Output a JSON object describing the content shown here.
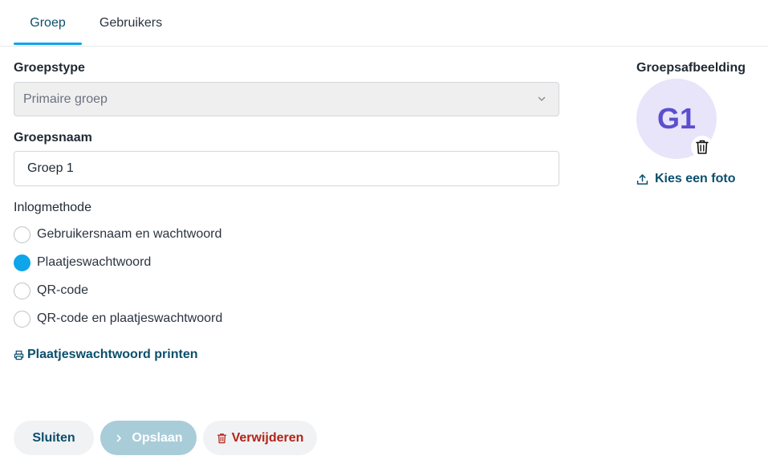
{
  "tabs": [
    {
      "label": "Groep",
      "active": true
    },
    {
      "label": "Gebruikers",
      "active": false
    }
  ],
  "form": {
    "group_type_label": "Groepstype",
    "group_type_value": "Primaire groep",
    "group_name_label": "Groepsnaam",
    "group_name_value": "Groep 1",
    "login_method_label": "Inlogmethode",
    "login_options": [
      {
        "label": "Gebruikersnaam en wachtwoord",
        "checked": false
      },
      {
        "label": "Plaatjeswachtwoord",
        "checked": true
      },
      {
        "label": "QR-code",
        "checked": false
      },
      {
        "label": "QR-code en plaatjeswachtwoord",
        "checked": false
      }
    ],
    "print_link": "Plaatjeswachtwoord printen"
  },
  "image": {
    "label": "Groepsafbeelding",
    "avatar_text": "G1",
    "choose_photo": "Kies een foto"
  },
  "actions": {
    "close": "Sluiten",
    "save": "Opslaan",
    "delete": "Verwijderen"
  },
  "colors": {
    "accent": "#0ea5e9",
    "link": "#0b4f6c",
    "danger": "#b42318",
    "avatar_bg": "#e8e4f9",
    "avatar_text": "#5b4fcf"
  },
  "icons": [
    "chevron-down-icon",
    "print-icon",
    "upload-icon",
    "trash-icon",
    "chevron-right-icon"
  ]
}
